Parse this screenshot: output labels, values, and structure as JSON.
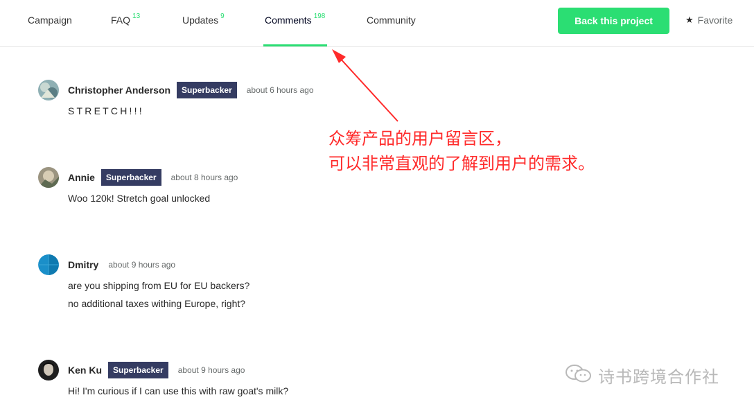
{
  "nav": {
    "tabs": [
      {
        "label": "Campaign",
        "count": ""
      },
      {
        "label": "FAQ",
        "count": "13"
      },
      {
        "label": "Updates",
        "count": "9"
      },
      {
        "label": "Comments",
        "count": "198"
      },
      {
        "label": "Community",
        "count": ""
      }
    ],
    "active_tab": "Comments",
    "back_button": "Back this project",
    "favorite_label": "Favorite"
  },
  "comments": [
    {
      "name": "Christopher Anderson",
      "badge": "Superbacker",
      "time": "about 6 hours ago",
      "lines": [
        "STRETCH!!!"
      ]
    },
    {
      "name": "Annie",
      "badge": "Superbacker",
      "time": "about 8 hours ago",
      "lines": [
        "Woo 120k! Stretch goal unlocked"
      ]
    },
    {
      "name": "Dmitry",
      "badge": "",
      "time": "about 9 hours ago",
      "lines": [
        "are you shipping from EU for EU backers?",
        "no additional taxes withing Europe, right?"
      ]
    },
    {
      "name": "Ken Ku",
      "badge": "Superbacker",
      "time": "about 9 hours ago",
      "lines": [
        "Hi! I'm curious if I can use this with raw goat's milk?"
      ]
    }
  ],
  "annotation": {
    "lines": [
      "众筹产品的用户留言区，",
      "可以非常直观的了解到用户的需求。"
    ],
    "color": "#ff2a2a"
  },
  "watermark": {
    "text": "诗书跨境合作社",
    "icon": "wechat-icon"
  },
  "colors": {
    "accent": "#2bde73",
    "badge": "#353c62"
  }
}
